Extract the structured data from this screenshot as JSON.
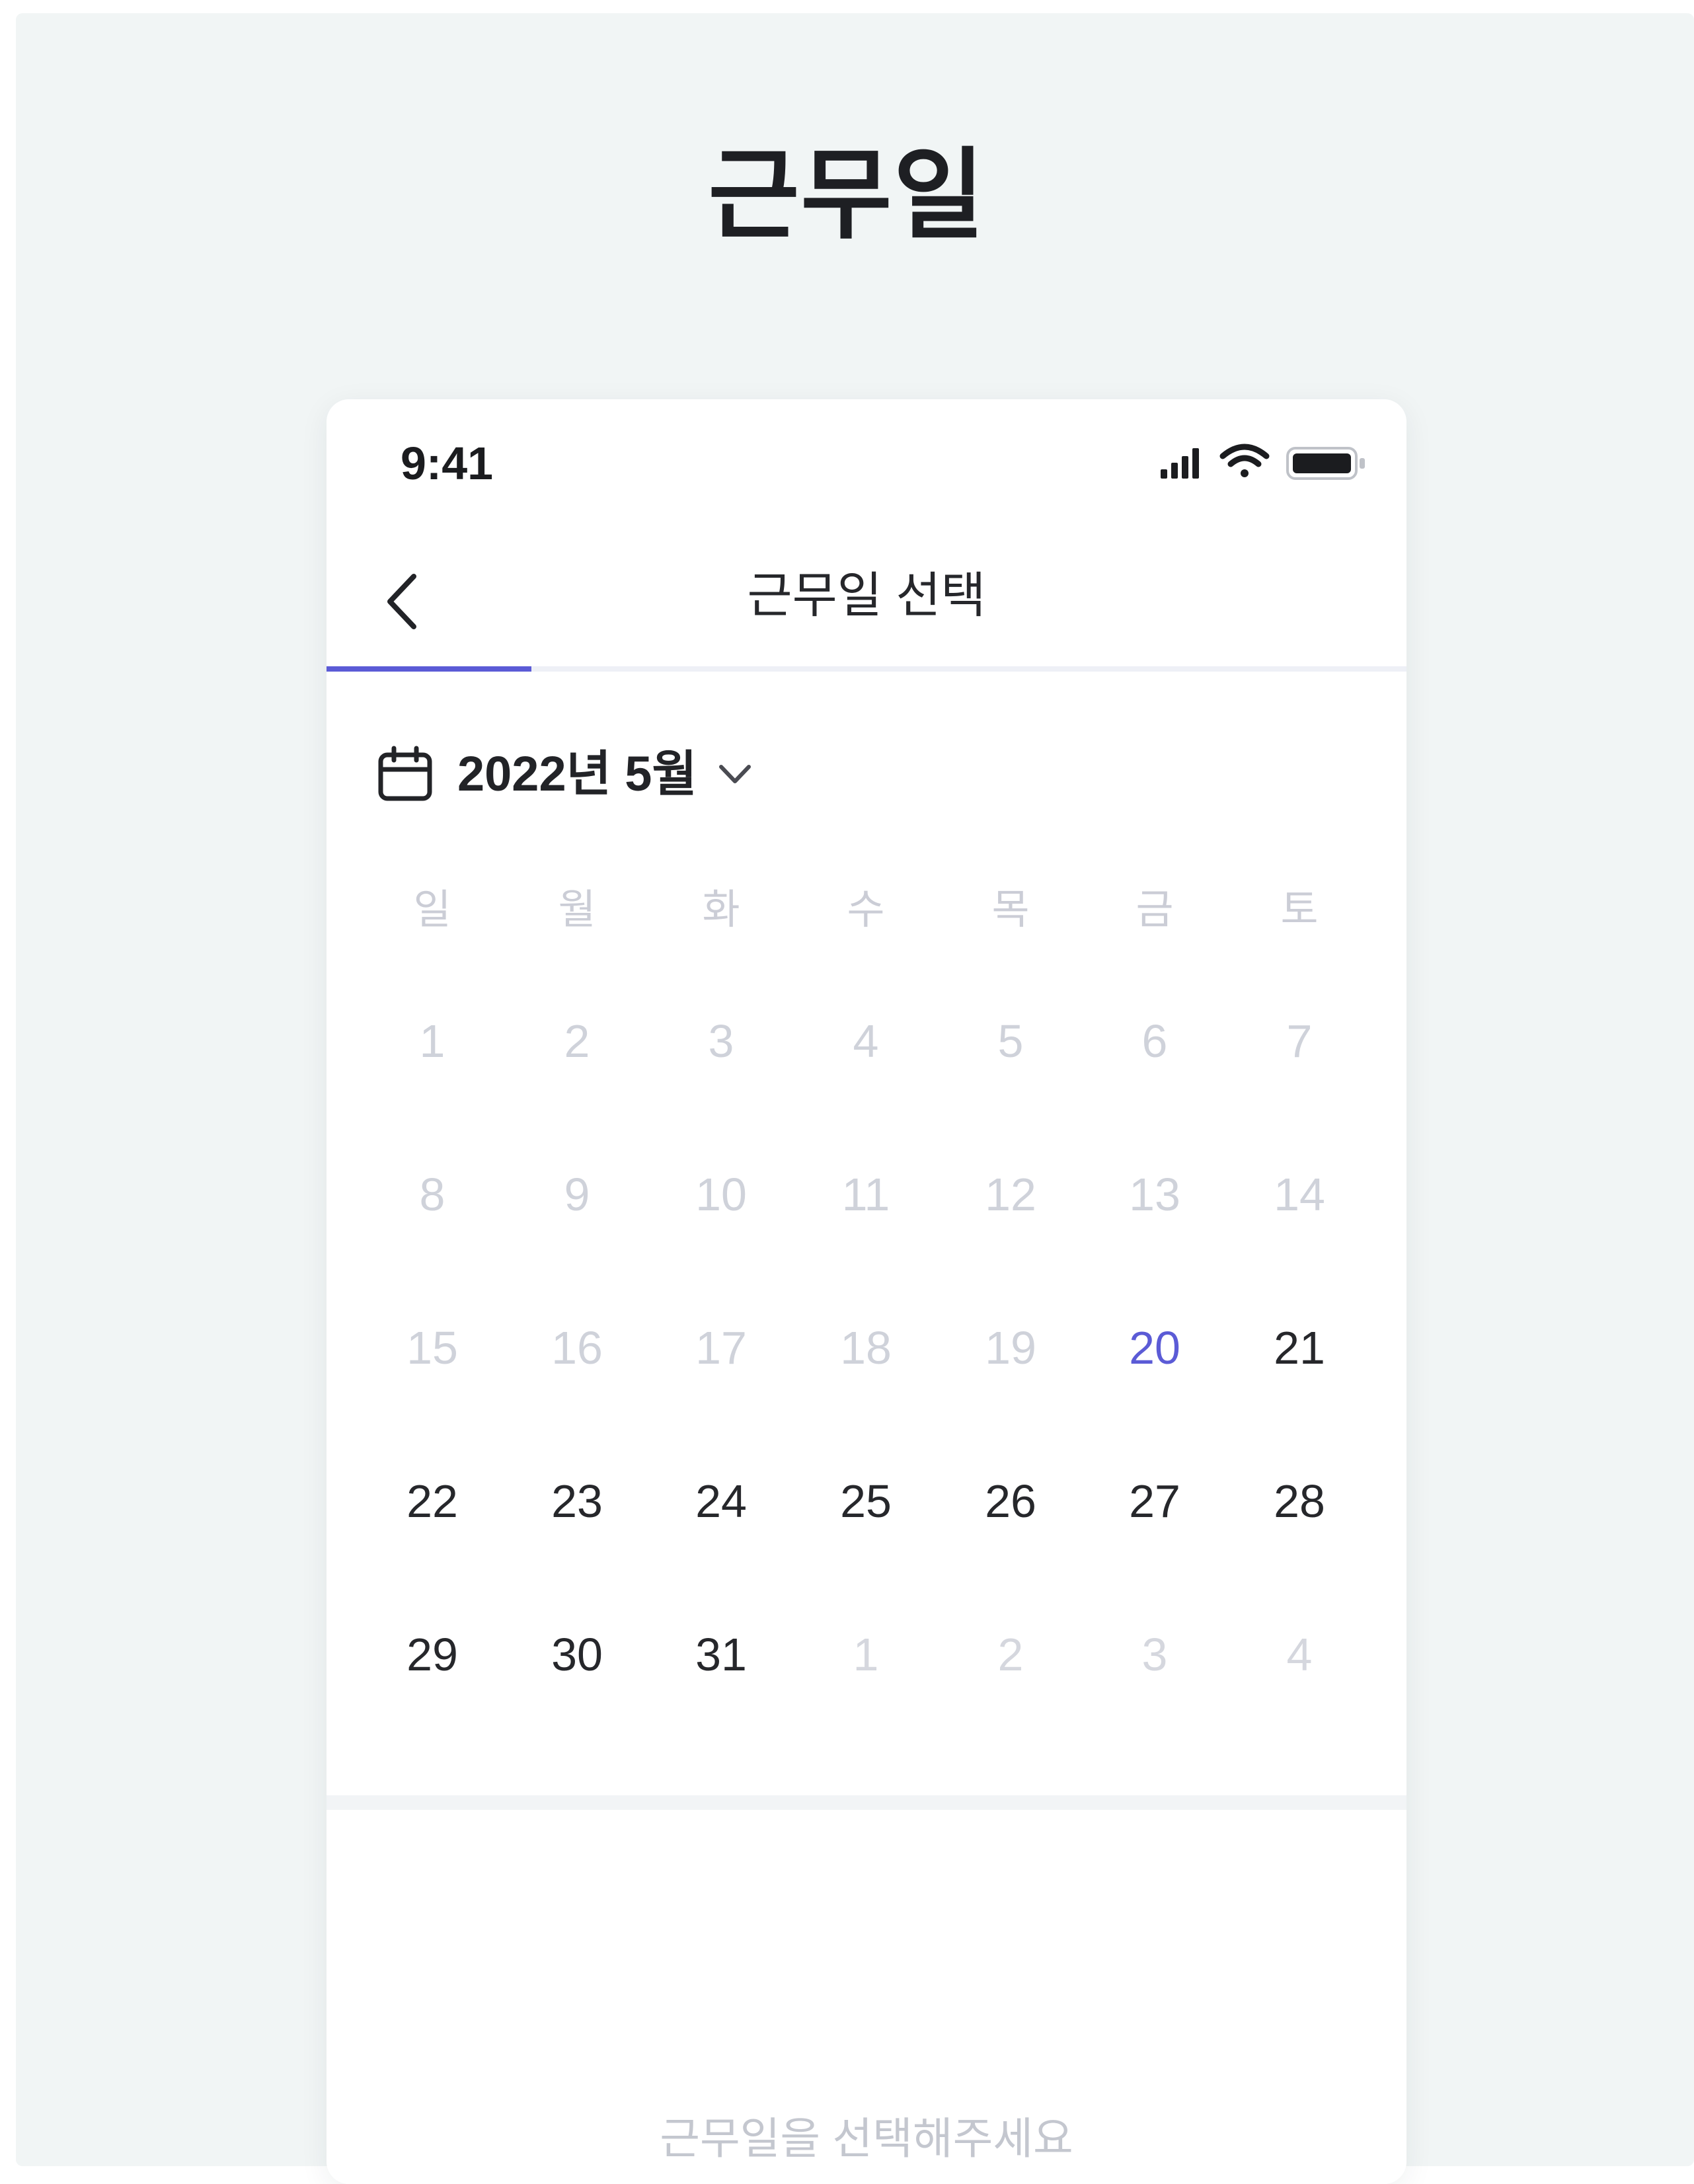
{
  "header": {
    "title": "근무일"
  },
  "status_bar": {
    "time": "9:41",
    "icons": [
      "signal-icon",
      "wifi-icon",
      "battery-icon"
    ]
  },
  "nav": {
    "back_icon": "chevron-left-icon",
    "title": "근무일 선택"
  },
  "progress": {
    "fraction": 0.19,
    "color": "#5b5bd6"
  },
  "month_selector": {
    "icon": "calendar-icon",
    "label": "2022년 5월",
    "dropdown_icon": "chevron-down-icon"
  },
  "calendar": {
    "weekdays": [
      "일",
      "월",
      "화",
      "수",
      "목",
      "금",
      "토"
    ],
    "weeks": [
      [
        {
          "label": "1",
          "state": "disabled"
        },
        {
          "label": "2",
          "state": "disabled"
        },
        {
          "label": "3",
          "state": "disabled"
        },
        {
          "label": "4",
          "state": "disabled"
        },
        {
          "label": "5",
          "state": "disabled"
        },
        {
          "label": "6",
          "state": "disabled"
        },
        {
          "label": "7",
          "state": "disabled"
        }
      ],
      [
        {
          "label": "8",
          "state": "disabled"
        },
        {
          "label": "9",
          "state": "disabled"
        },
        {
          "label": "10",
          "state": "disabled"
        },
        {
          "label": "11",
          "state": "disabled"
        },
        {
          "label": "12",
          "state": "disabled"
        },
        {
          "label": "13",
          "state": "disabled"
        },
        {
          "label": "14",
          "state": "disabled"
        }
      ],
      [
        {
          "label": "15",
          "state": "disabled"
        },
        {
          "label": "16",
          "state": "disabled"
        },
        {
          "label": "17",
          "state": "disabled"
        },
        {
          "label": "18",
          "state": "disabled"
        },
        {
          "label": "19",
          "state": "disabled"
        },
        {
          "label": "20",
          "state": "today"
        },
        {
          "label": "21",
          "state": "available"
        }
      ],
      [
        {
          "label": "22",
          "state": "available"
        },
        {
          "label": "23",
          "state": "available"
        },
        {
          "label": "24",
          "state": "available"
        },
        {
          "label": "25",
          "state": "available"
        },
        {
          "label": "26",
          "state": "available"
        },
        {
          "label": "27",
          "state": "available"
        },
        {
          "label": "28",
          "state": "available"
        }
      ],
      [
        {
          "label": "29",
          "state": "available"
        },
        {
          "label": "30",
          "state": "available"
        },
        {
          "label": "31",
          "state": "available"
        },
        {
          "label": "1",
          "state": "outside"
        },
        {
          "label": "2",
          "state": "outside"
        },
        {
          "label": "3",
          "state": "outside"
        },
        {
          "label": "4",
          "state": "outside"
        }
      ]
    ]
  },
  "bottom_panel": {
    "hint": "근무일을 선택해주세요"
  },
  "colors": {
    "accent": "#5b5bd6",
    "page_background": "#f1f5f5",
    "text_primary": "#26272b",
    "text_disabled": "#cfd2da"
  }
}
